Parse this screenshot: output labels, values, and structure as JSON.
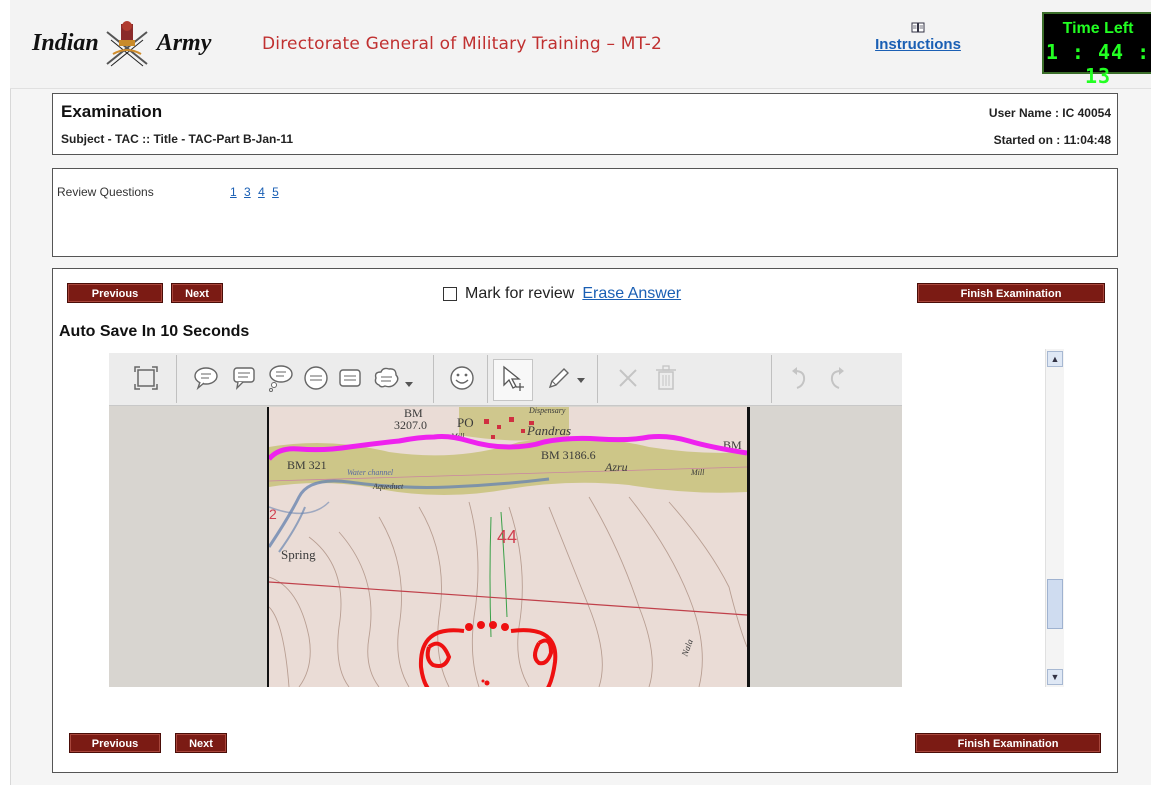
{
  "header": {
    "brand_left": "Indian",
    "brand_right": "Army",
    "title": "Directorate General of Military Training – MT-2",
    "instructions_label": "Instructions",
    "timer_label": "Time Left",
    "timer_value": "1 : 44 : 13"
  },
  "exam": {
    "heading": "Examination",
    "subject_line": "Subject - TAC :: Title - TAC-Part B-Jan-11",
    "user_name": "User Name : IC 40054",
    "started_on_label": "Started on : ",
    "started_on_value": "11:04:48"
  },
  "review": {
    "label": "Review Questions",
    "links": [
      "1",
      "3",
      "4",
      "5"
    ]
  },
  "question": {
    "previous_label": "Previous",
    "next_label": "Next",
    "mark_review_label": "Mark for review",
    "erase_label": "Erase Answer",
    "finish_label": "Finish Examination",
    "autosave_text": "Auto Save In 10 Seconds"
  },
  "map_labels": {
    "bm_top": "BM",
    "bm_top_val": "3207.0",
    "po": "PO",
    "mill_top": "Mill",
    "pandras": "Pandras",
    "dispensary": "Dispensary",
    "bm_right": "BM",
    "bm_left": "BM 321",
    "bm_mid": "BM 3186.6",
    "azru": "Azru",
    "mill_right": "Mill",
    "water_channel": "Water channel",
    "aqueduct": "Aqueduct",
    "spring": "Spring",
    "grid_44": "44",
    "grid_2": "2",
    "nala": "Nala"
  },
  "colors": {
    "button_bg": "#7b1b14",
    "link": "#1a5fb4",
    "timer_text": "#22ff22",
    "title_red": "#c03030",
    "pen_magenta": "#ee22ee",
    "pen_red": "#ee1111"
  },
  "icons": [
    "fit-page-icon",
    "speech-bubble-icon",
    "callout-icon",
    "thought-bubble-icon",
    "circle-text-icon",
    "rect-text-icon",
    "cloud-text-icon",
    "dropdown-arrow-icon",
    "smiley-icon",
    "select-cursor-icon",
    "pencil-icon",
    "delete-x-icon",
    "trash-icon",
    "undo-icon",
    "redo-icon"
  ]
}
